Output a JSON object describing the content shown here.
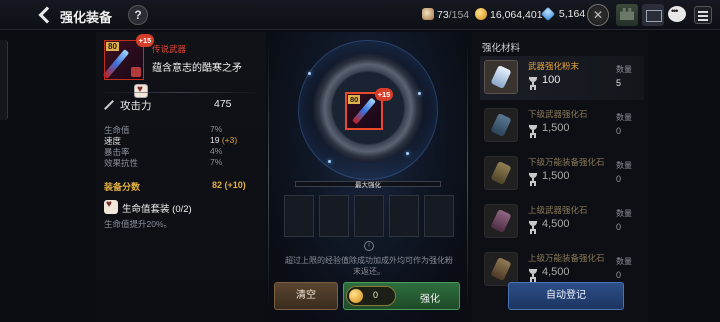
{
  "header": {
    "title": "强化装备",
    "help": "?",
    "stamina": {
      "current": "73",
      "max": "/154"
    },
    "gold": "16,064,401",
    "gems": "5,164"
  },
  "item": {
    "level": "80",
    "plus": "+15",
    "rarity": "传说武器",
    "name": "蕴含意志的酷寒之矛"
  },
  "stats": {
    "attack_label": "攻击力",
    "attack_value": "475",
    "rows": [
      {
        "label": "生命值",
        "value": "7%",
        "bonus": ""
      },
      {
        "label": "速度",
        "value": "19",
        "bonus": "(+3)"
      },
      {
        "label": "暴击率",
        "value": "4%",
        "bonus": ""
      },
      {
        "label": "效果抗性",
        "value": "7%",
        "bonus": ""
      }
    ],
    "score_label": "装备分数",
    "score_value": "82",
    "score_bonus": "(+10)",
    "set_name": "生命值套装",
    "set_count": "(0/2)",
    "set_desc": "生命值提升20%。"
  },
  "center": {
    "progress_label": "最大强化",
    "info_text": "超过上限的经验值除成功加成外均可作为强化粉末返还。",
    "clear_label": "清空",
    "cost": "0",
    "enhance_label": "强化"
  },
  "materials": {
    "title": "强化材料",
    "qty_label": "数量",
    "items": [
      {
        "name": "武器强化粉末",
        "value": "100",
        "qty": "5"
      },
      {
        "name": "下级武器强化石",
        "value": "1,500",
        "qty": "0"
      },
      {
        "name": "下级万能装备强化石",
        "value": "1,500",
        "qty": "0"
      },
      {
        "name": "上级武器强化石",
        "value": "4,500",
        "qty": "0"
      },
      {
        "name": "上级万能装备强化石",
        "value": "4,500",
        "qty": "0"
      }
    ],
    "auto_label": "自动登记"
  },
  "colors": {
    "rarity_red": "#e3463a",
    "gold_text": "#e4a23a",
    "enhance_green": "#2e6e3e",
    "auto_blue": "#2c4f88"
  }
}
